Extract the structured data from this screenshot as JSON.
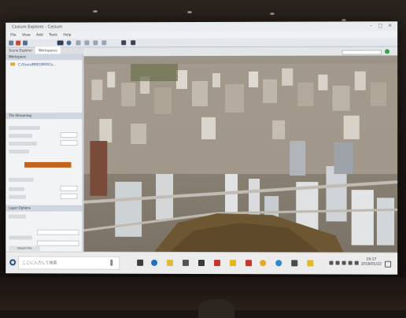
{
  "window": {
    "title": "Cesium Explorer - Cesium",
    "menu": [
      "File",
      "View",
      "Add",
      "Tools",
      "Help"
    ]
  },
  "sidebar": {
    "tabs": [
      "Scene Explorer",
      "Workspaces"
    ],
    "panel1_title": "Workspace",
    "path": "C:/Users/MEEGMAP/Ce...",
    "panel2_title": "Tile Streaming",
    "panel3_title": "Layer Options",
    "button_label": "Import File"
  },
  "taskbar": {
    "search_placeholder": "ここに入力して検索",
    "time": "19:17",
    "date": "2018/01/22"
  },
  "colors": {
    "accent_orange": "#c4651f",
    "taskbar_bg": "#ececec",
    "sidebar_header": "#cfd6df"
  }
}
